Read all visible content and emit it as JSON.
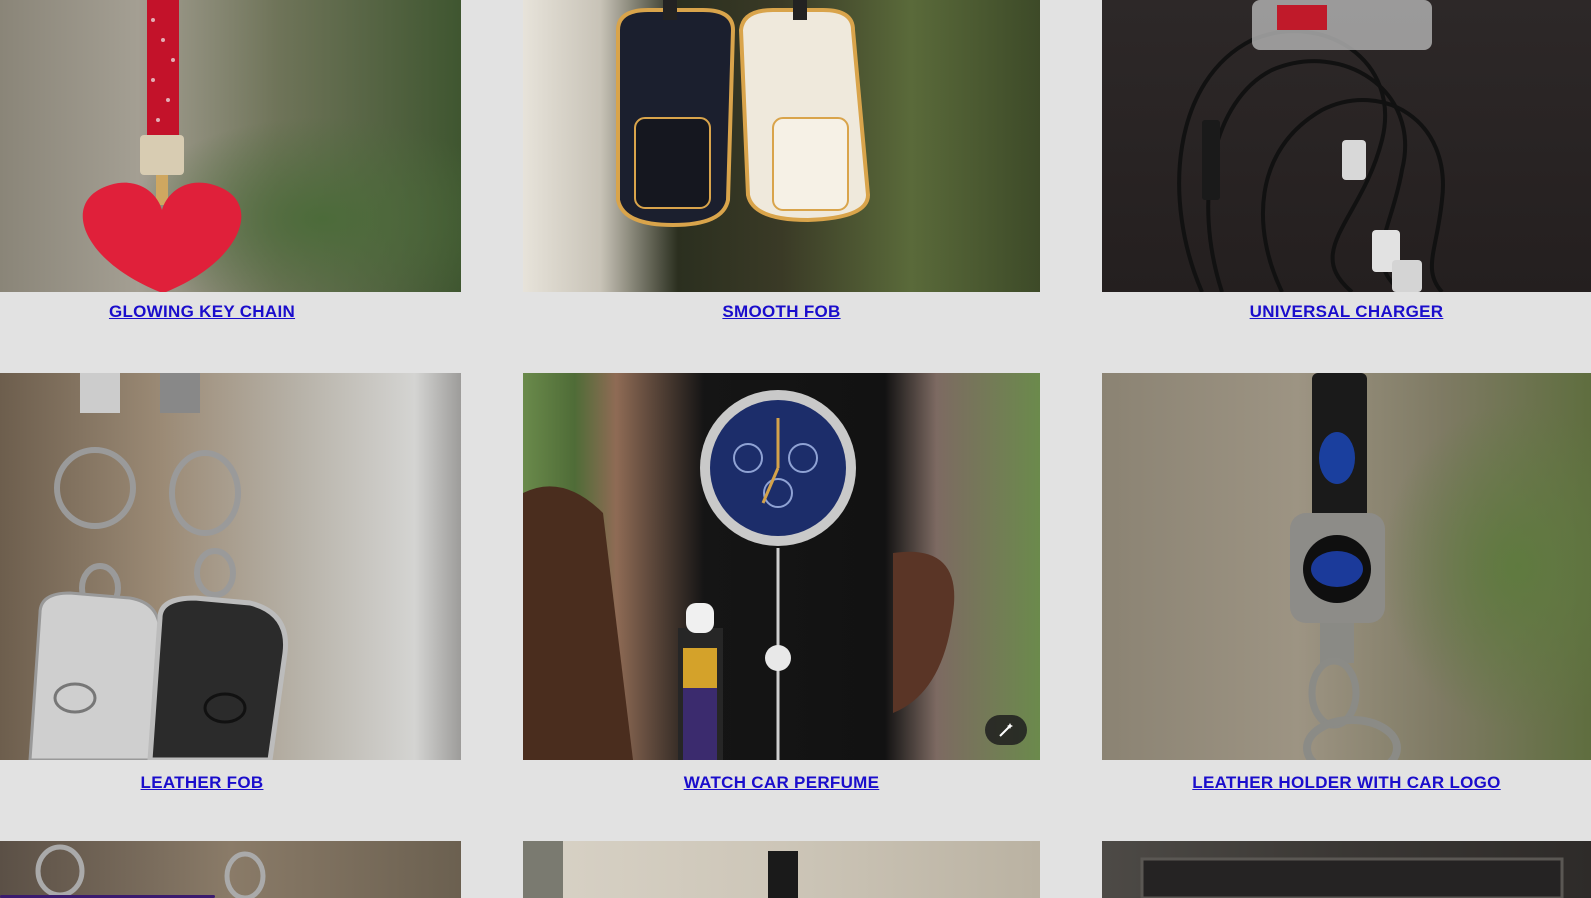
{
  "products": [
    {
      "caption": "GLOWING KEY CHAIN",
      "image_desc": "red rhinestone heart key chain"
    },
    {
      "caption": "SMOOTH FOB",
      "image_desc": "black and white key fob covers"
    },
    {
      "caption": "UNIVERSAL CHARGER",
      "image_desc": "braided charging cable with jeweled connectors"
    },
    {
      "caption": "LEATHER FOB",
      "image_desc": "toyota leather key fob covers"
    },
    {
      "caption": "WATCH CAR PERFUME",
      "image_desc": "watch style car perfume in box"
    },
    {
      "caption": "LEATHER HOLDER WITH CAR LOGO",
      "image_desc": "subaru leather key holder"
    }
  ],
  "colors": {
    "background": "#e2e2e2",
    "link": "#1a0dcc",
    "accent_strip": "#3a1a6e"
  },
  "icons": {
    "magic": "magic-wand-icon"
  }
}
